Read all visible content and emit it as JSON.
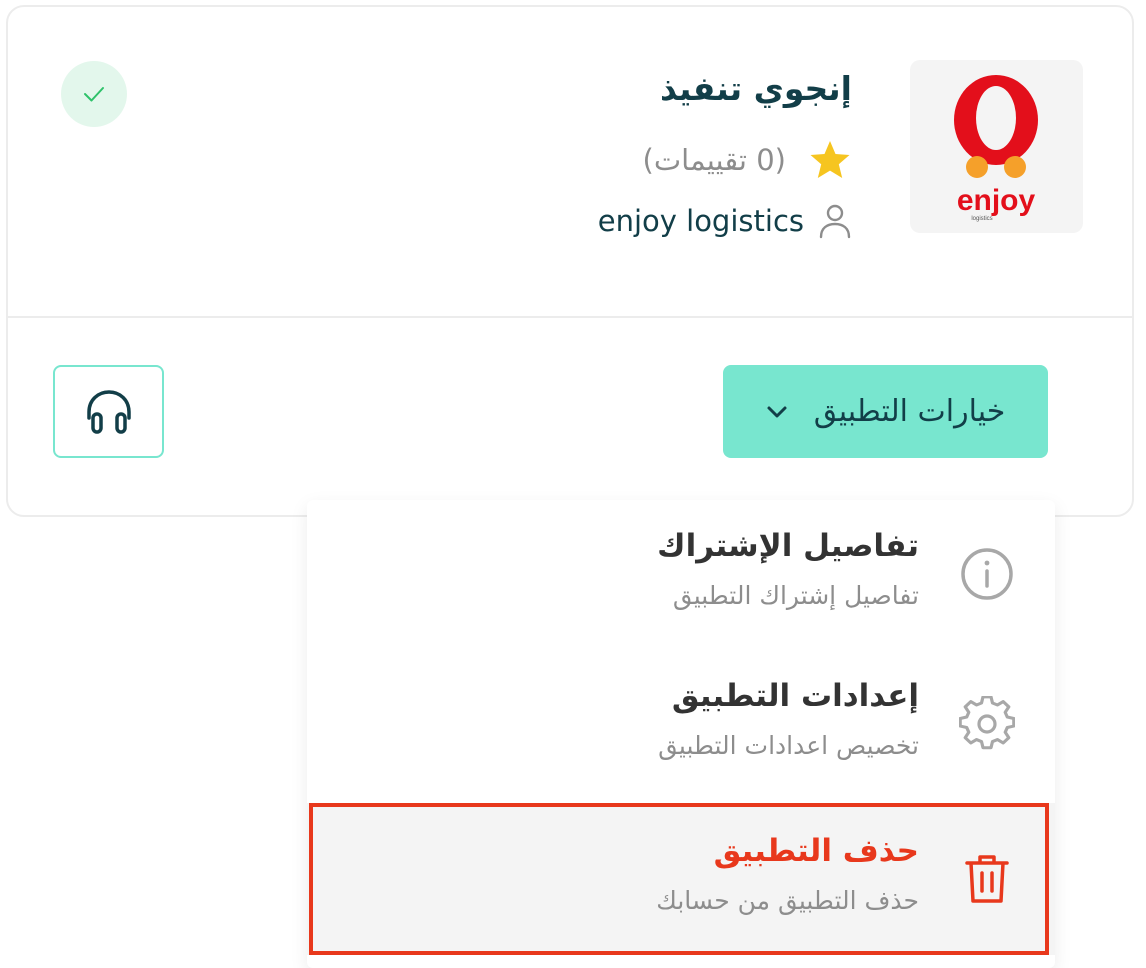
{
  "app": {
    "title": "إنجوي تنفيذ",
    "rating_text": "(0 تقييمات)",
    "publisher": "enjoy logistics",
    "logo_text": "enjoy",
    "logo_subtext": "logistics"
  },
  "actions": {
    "options_label": "خيارات التطبيق"
  },
  "menu": {
    "items": [
      {
        "title": "تفاصيل الإشتراك",
        "subtitle": "تفاصيل إشتراك التطبيق"
      },
      {
        "title": "إعدادات التطبيق",
        "subtitle": "تخصيص اعدادات التطبيق"
      },
      {
        "title": "حذف التطبيق",
        "subtitle": "حذف التطبيق من حسابك"
      }
    ]
  },
  "colors": {
    "brand_dark": "#123e48",
    "accent": "#78e6cf",
    "danger": "#e8381c",
    "muted": "#8d8d8d",
    "success": "#2ec26a",
    "success_bg": "#e3f7ec",
    "star": "#f6c520"
  },
  "icons": {
    "status": "check-icon",
    "rating": "star-icon",
    "publisher": "user-icon",
    "dropdown": "chevron-down-icon",
    "support": "headphones-icon",
    "item_0": "info-icon",
    "item_1": "gear-icon",
    "item_2": "trash-icon"
  }
}
